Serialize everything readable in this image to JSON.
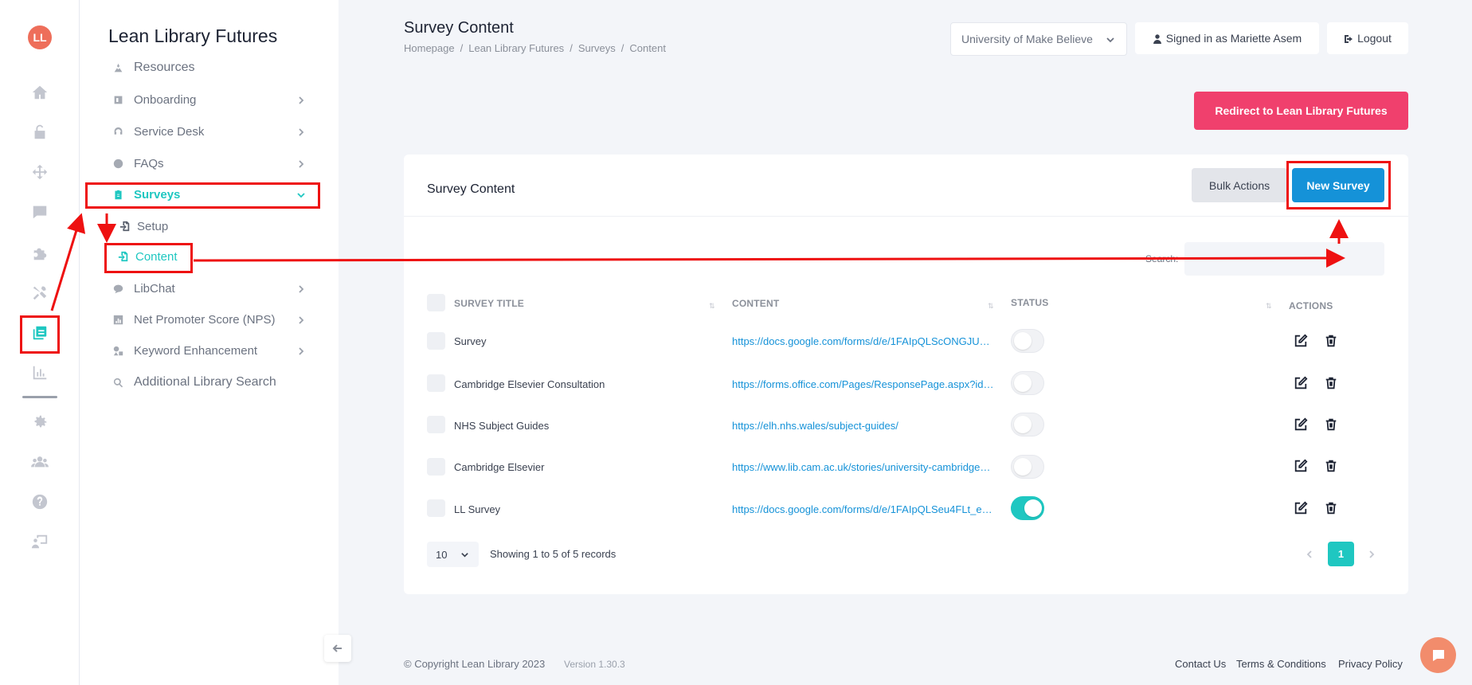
{
  "rail": {
    "logo_text": "LL",
    "icons": [
      "home-icon",
      "unlock-icon",
      "arrows-move-icon",
      "comment-icon",
      "puzzle-icon",
      "tools-icon",
      "surveys-icon",
      "bar-chart-icon",
      "gear-icon",
      "users-icon",
      "question-icon",
      "presenter-icon"
    ]
  },
  "sidebar": {
    "title": "Lean Library Futures",
    "items": [
      {
        "label": "Resources"
      },
      {
        "label": "Onboarding"
      },
      {
        "label": "Service Desk"
      },
      {
        "label": "FAQs"
      },
      {
        "label": "Surveys"
      },
      {
        "label": "LibChat"
      },
      {
        "label": "Net Promoter Score (NPS)"
      },
      {
        "label": "Keyword Enhancement"
      },
      {
        "label": "Additional Library Search"
      }
    ],
    "sub_items": [
      {
        "label": "Setup"
      },
      {
        "label": "Content"
      }
    ]
  },
  "header": {
    "title": "Survey Content",
    "breadcrumb": [
      "Homepage",
      "Lean Library Futures",
      "Surveys",
      "Content"
    ],
    "separator": "/",
    "institution": "University of Make Believe",
    "signed_in": "Signed in as Mariette Asem",
    "logout": "Logout",
    "redirect": "Redirect to Lean Library Futures"
  },
  "card": {
    "title": "Survey Content",
    "bulk_actions": "Bulk Actions",
    "new_survey": "New Survey",
    "search_label": "Search:",
    "columns": [
      "SURVEY TITLE",
      "CONTENT",
      "STATUS",
      "ACTIONS"
    ],
    "rows": [
      {
        "title": "Survey",
        "content": "https://docs.google.com/forms/d/e/1FAIpQLScONGJU…",
        "status": false
      },
      {
        "title": "Cambridge Elsevier Consultation",
        "content": "https://forms.office.com/Pages/ResponsePage.aspx?id…",
        "status": false
      },
      {
        "title": "NHS Subject Guides",
        "content": "https://elh.nhs.wales/subject-guides/",
        "status": false
      },
      {
        "title": "Cambridge Elsevier",
        "content": "https://www.lib.cam.ac.uk/stories/university-cambridge…",
        "status": false
      },
      {
        "title": "LL Survey",
        "content": "https://docs.google.com/forms/d/e/1FAIpQLSeu4FLt_e…",
        "status": true
      }
    ],
    "per_page": "10",
    "showing": "Showing 1 to 5 of 5 records",
    "current_page": "1"
  },
  "footer": {
    "copyright": "© Copyright Lean Library 2023",
    "version": "Version 1.30.3",
    "links": [
      "Contact Us",
      "Terms & Conditions",
      "Privacy Policy"
    ]
  },
  "colors": {
    "accent": "#1fc7c1",
    "primary": "#1592d8",
    "danger": "#f0406d",
    "annotation": "#ee1111"
  }
}
